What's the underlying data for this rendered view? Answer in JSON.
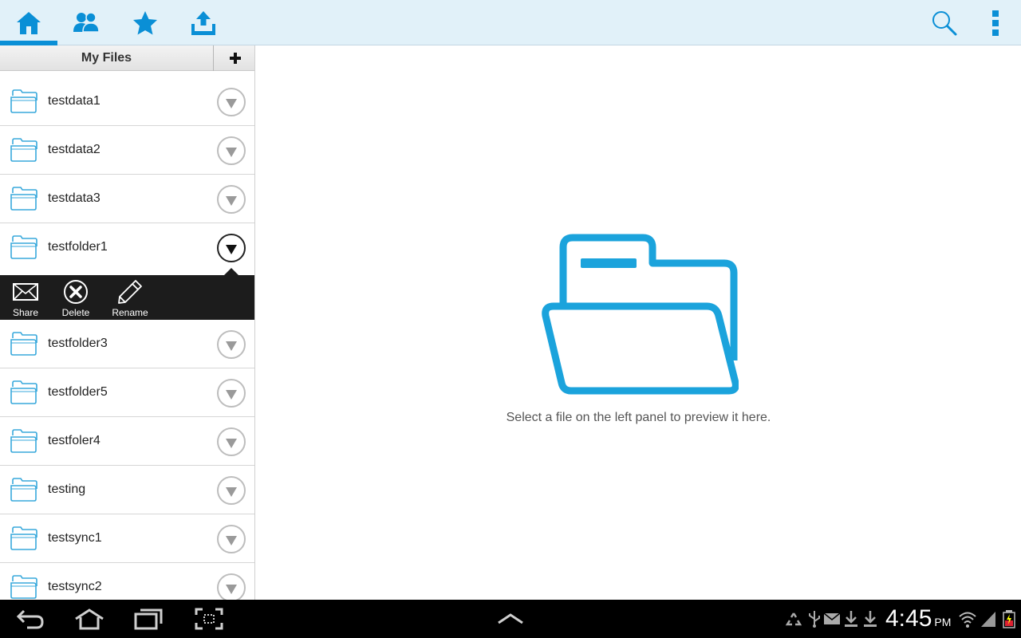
{
  "toolbar": {
    "tabs": [
      {
        "icon": "home-icon",
        "active": true
      },
      {
        "icon": "people-icon",
        "active": false
      },
      {
        "icon": "star-icon",
        "active": false
      },
      {
        "icon": "upload-icon",
        "active": false
      }
    ],
    "right": [
      "search-icon",
      "overflow-menu-icon"
    ]
  },
  "panel": {
    "title": "My Files",
    "add_label": "+"
  },
  "files": [
    {
      "name": "testdata1"
    },
    {
      "name": "testdata2"
    },
    {
      "name": "testdata3"
    },
    {
      "name": "testfolder1",
      "expanded": true
    },
    {
      "name": "testfolder3"
    },
    {
      "name": "testfolder5"
    },
    {
      "name": "testfoler4"
    },
    {
      "name": "testing"
    },
    {
      "name": "testsync1"
    },
    {
      "name": "testsync2"
    }
  ],
  "actions": {
    "share": "Share",
    "delete": "Delete",
    "rename": "Rename"
  },
  "preview": {
    "hint": "Select a file on the left panel to preview it here."
  },
  "status": {
    "time": "4:45",
    "ampm": "PM"
  },
  "colors": {
    "accent": "#0a8fd6",
    "topbar": "#e1f1f9",
    "folder_outline": "#1ba3dc"
  }
}
